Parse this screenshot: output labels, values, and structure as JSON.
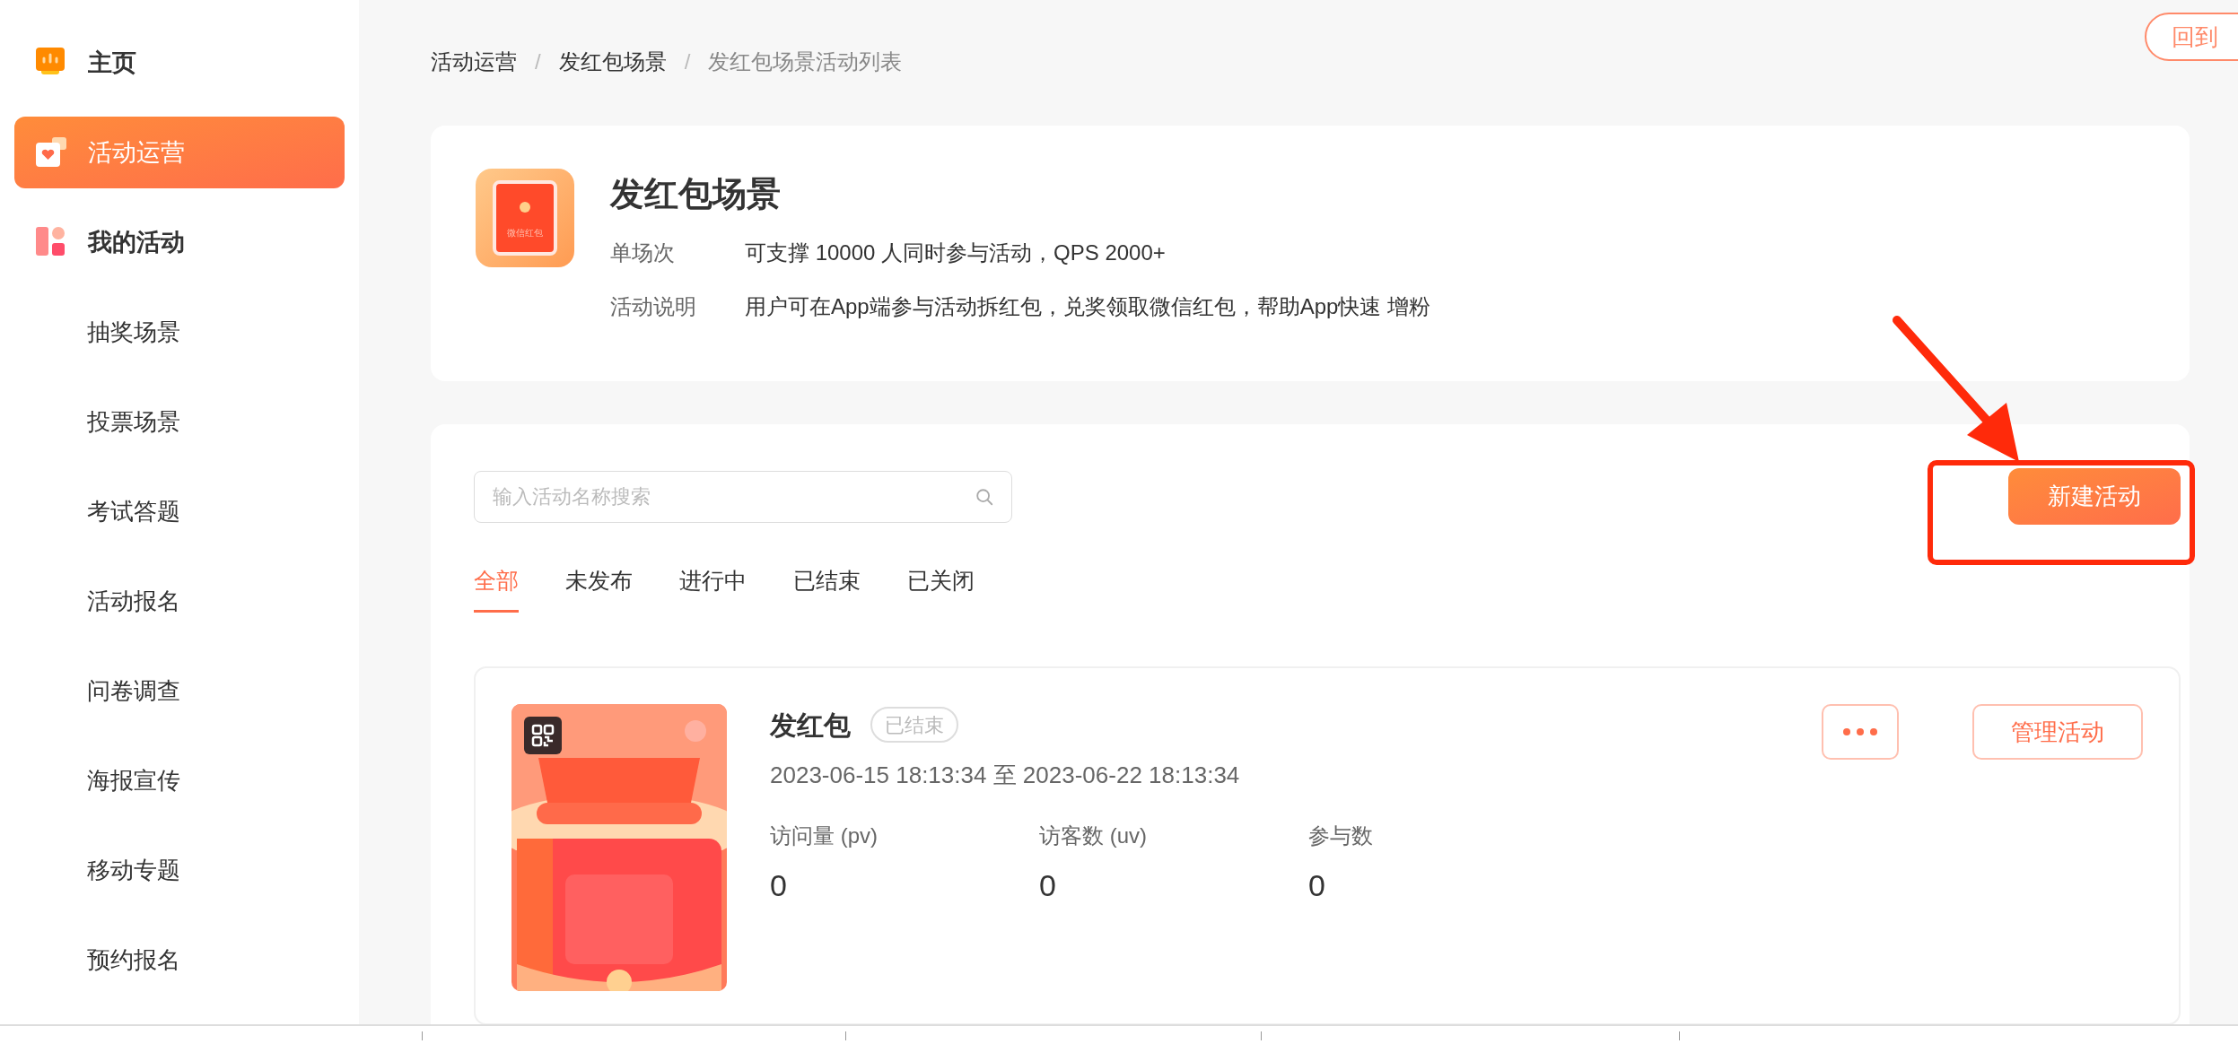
{
  "sidebar": {
    "items": [
      {
        "label": "主页",
        "kind": "home",
        "selected": false
      },
      {
        "label": "活动运营",
        "kind": "ops",
        "selected": true
      },
      {
        "label": "我的活动",
        "kind": "mine",
        "selected": false,
        "children": [
          {
            "label": "抽奖场景",
            "selected": false
          },
          {
            "label": "投票场景",
            "selected": false
          },
          {
            "label": "考试答题",
            "selected": false
          },
          {
            "label": "活动报名",
            "selected": false
          },
          {
            "label": "问卷调查",
            "selected": false
          },
          {
            "label": "海报宣传",
            "selected": false
          },
          {
            "label": "移动专题",
            "selected": false
          },
          {
            "label": "预约报名",
            "selected": false
          }
        ]
      }
    ]
  },
  "top_button": {
    "label": "回到"
  },
  "breadcrumb": {
    "separator": "/",
    "items": [
      "活动运营",
      "发红包场景",
      "发红包场景活动列表"
    ]
  },
  "scene": {
    "title": "发红包场景",
    "icon_label": "微信红包",
    "details": [
      {
        "label": "单场次",
        "value": "可支撑 10000 人同时参与活动，QPS 2000+"
      },
      {
        "label": "活动说明",
        "value": "用户可在App端参与活动拆红包，兑奖领取微信红包，帮助App快速 增粉"
      }
    ]
  },
  "search": {
    "placeholder": "输入活动名称搜索"
  },
  "new_button": {
    "label": "新建活动"
  },
  "tabs": [
    {
      "label": "全部",
      "selected": true
    },
    {
      "label": "未发布",
      "selected": false
    },
    {
      "label": "进行中",
      "selected": false
    },
    {
      "label": "已结束",
      "selected": false
    },
    {
      "label": "已关闭",
      "selected": false
    }
  ],
  "activities": [
    {
      "title": "发红包",
      "status": "已结束",
      "period": "2023-06-15 18:13:34 至 2023-06-22 18:13:34",
      "manage": "管理活动",
      "stats": [
        {
          "label": "访问量 (pv)",
          "value": "0"
        },
        {
          "label": "访客数 (uv)",
          "value": "0"
        },
        {
          "label": "参与数",
          "value": "0"
        }
      ]
    }
  ]
}
